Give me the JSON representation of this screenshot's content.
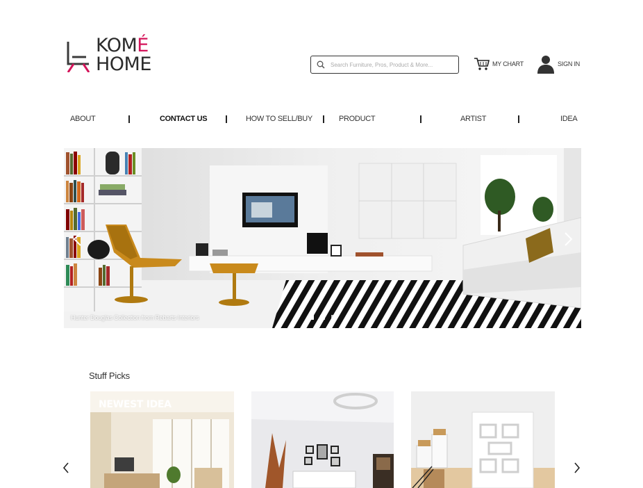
{
  "brand": {
    "line1": "KOM",
    "accent": "É",
    "line2": "HOME",
    "accent_color": "#d4145a"
  },
  "header": {
    "search_placeholder": "Search Furniture, Pros, Product & More...",
    "cart_label": "MY CHART",
    "signin_label": "SIGN IN"
  },
  "nav": {
    "items": [
      {
        "label": "ABOUT",
        "bold": false
      },
      {
        "label": "CONTACT US",
        "bold": true
      },
      {
        "label": "HOW TO SELL/BUY",
        "bold": false
      },
      {
        "label": "PRODUCT",
        "bold": false
      },
      {
        "label": "ARTIST",
        "bold": false
      },
      {
        "label": "IDEA",
        "bold": false
      }
    ]
  },
  "hero": {
    "caption": "Hunter Douglas Collection from Rebarts Interiors",
    "slide_count": 3,
    "active_slide": 1
  },
  "picks": {
    "title": "Stuff Picks",
    "cards": [
      {
        "badge": "NEWEST IDEA"
      },
      {
        "badge": ""
      },
      {
        "badge": ""
      }
    ]
  },
  "icons": {
    "search": "search-icon",
    "cart": "cart-icon",
    "user": "user-icon",
    "prev": "chevron-left-icon",
    "next": "chevron-right-icon"
  }
}
